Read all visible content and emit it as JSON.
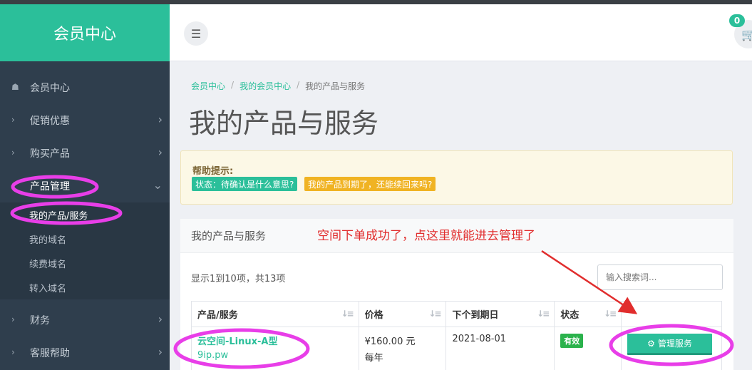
{
  "sidebar": {
    "logo": "会员中心",
    "items": [
      {
        "label": "会员中心",
        "lead": "☗"
      },
      {
        "label": "促销优惠",
        "lead": "›",
        "caret": "›"
      },
      {
        "label": "购买产品",
        "lead": "›",
        "caret": "›"
      },
      {
        "label": "产品管理",
        "lead": "›",
        "caret": "⌄"
      }
    ],
    "sub_items": [
      "我的产品/服务",
      "我的域名",
      "续费域名",
      "转入域名"
    ],
    "bottom_items": [
      {
        "label": "财务",
        "lead": "›",
        "caret": "›"
      },
      {
        "label": "客服帮助",
        "lead": "›",
        "caret": "›"
      }
    ]
  },
  "header": {
    "menu_icon": "☰",
    "cart_icon": "🛒",
    "cart_count": "0"
  },
  "breadcrumb": {
    "items": [
      "会员中心",
      "我的会员中心",
      "我的产品与服务"
    ],
    "sep": "/"
  },
  "page_title": "我的产品与服务",
  "help": {
    "title": "帮助提示:",
    "tag1": "状态：待确认是什么意思?",
    "tag2": "我的产品到期了，还能续回来吗?"
  },
  "panel": {
    "title": "我的产品与服务",
    "summary": "显示1到10项，共13项",
    "search_placeholder": "输入搜索词...",
    "columns": [
      "产品/服务",
      "价格",
      "下个到期日",
      "状态",
      ""
    ],
    "sort_icon": "↓≡",
    "rows": [
      {
        "product": "云空间-Linux-A型",
        "domain": "9ip.pw",
        "price": "¥160.00 元",
        "cycle": "每年",
        "due": "2021-08-01",
        "status": "有效",
        "action": "管理服务",
        "action_icon": "⚙"
      }
    ]
  },
  "annotation": {
    "text": "空间下单成功了，点这里就能进去管理了",
    "color": "#e12d2d",
    "circle_color": "#e83ee8"
  },
  "colors": {
    "accent": "#2bbf9a",
    "sidebar_bg": "#2f3e4d",
    "status_green": "#2bb24c",
    "tag_yellow": "#f0b323"
  }
}
